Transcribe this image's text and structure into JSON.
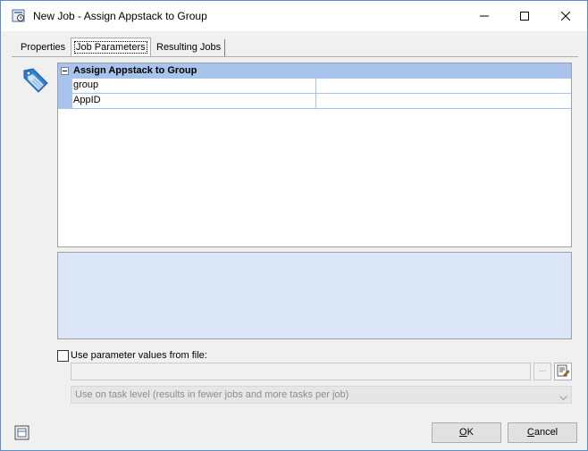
{
  "window": {
    "title": "New Job - Assign Appstack to Group"
  },
  "tabs": [
    {
      "label": "Properties"
    },
    {
      "label": "Job Parameters"
    },
    {
      "label": "Resulting Jobs"
    }
  ],
  "grid": {
    "category": "Assign Appstack to Group",
    "rows": [
      {
        "name": "group",
        "value": ""
      },
      {
        "name": "AppID",
        "value": ""
      }
    ]
  },
  "file_option": {
    "label": "Use parameter values from file:",
    "checked": false,
    "path_value": "",
    "browse_label": "...",
    "level_selected": "Use on task level (results in fewer jobs and more tasks per job)"
  },
  "buttons": {
    "ok_mnemonic": "O",
    "ok_rest": "K",
    "cancel_mnemonic": "C",
    "cancel_rest": "ancel"
  },
  "colors": {
    "header_bg": "#a8c4ec",
    "description_bg": "#dbe6f6"
  }
}
